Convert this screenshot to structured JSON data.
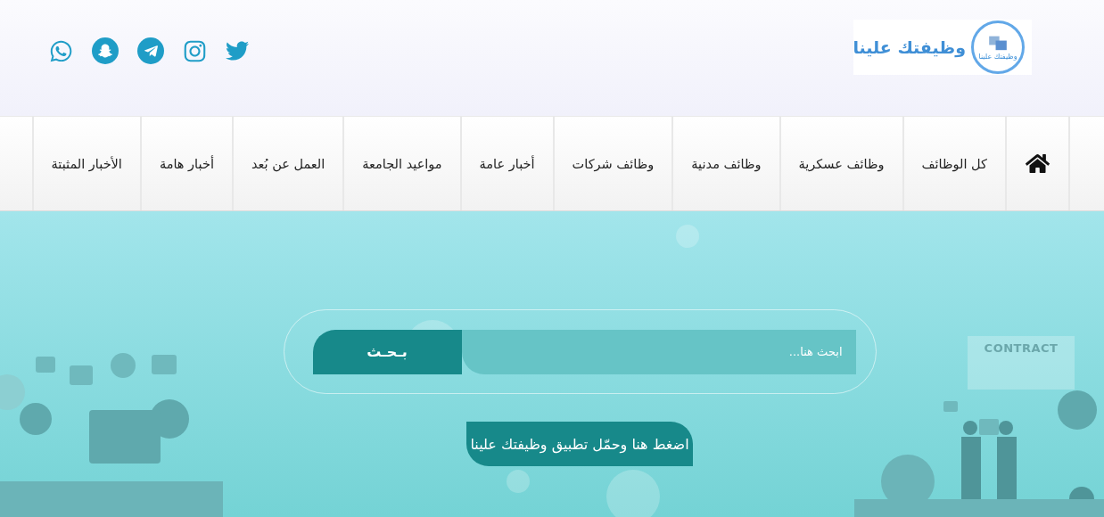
{
  "logo": {
    "title": "وظيفتك علينا",
    "badge_text": "وظيفتك علينا"
  },
  "nav": {
    "items": [
      {
        "label": "كل الوظائف"
      },
      {
        "label": "وظائف عسكرية"
      },
      {
        "label": "وظائف مدنية"
      },
      {
        "label": "وظائف شركات"
      },
      {
        "label": "أخبار عامة"
      },
      {
        "label": "مواعيد الجامعة"
      },
      {
        "label": "العمل عن بُعد"
      },
      {
        "label": "أخبار هامة"
      },
      {
        "label": "الأخبار المثبتة"
      }
    ]
  },
  "search": {
    "placeholder": "ابحث هنا...",
    "button": "بـحـث"
  },
  "download_button": "اضغط هنا وحمّل تطبيق وظيفتك علينا",
  "illustration": {
    "contract_label": "CONTRACT"
  }
}
